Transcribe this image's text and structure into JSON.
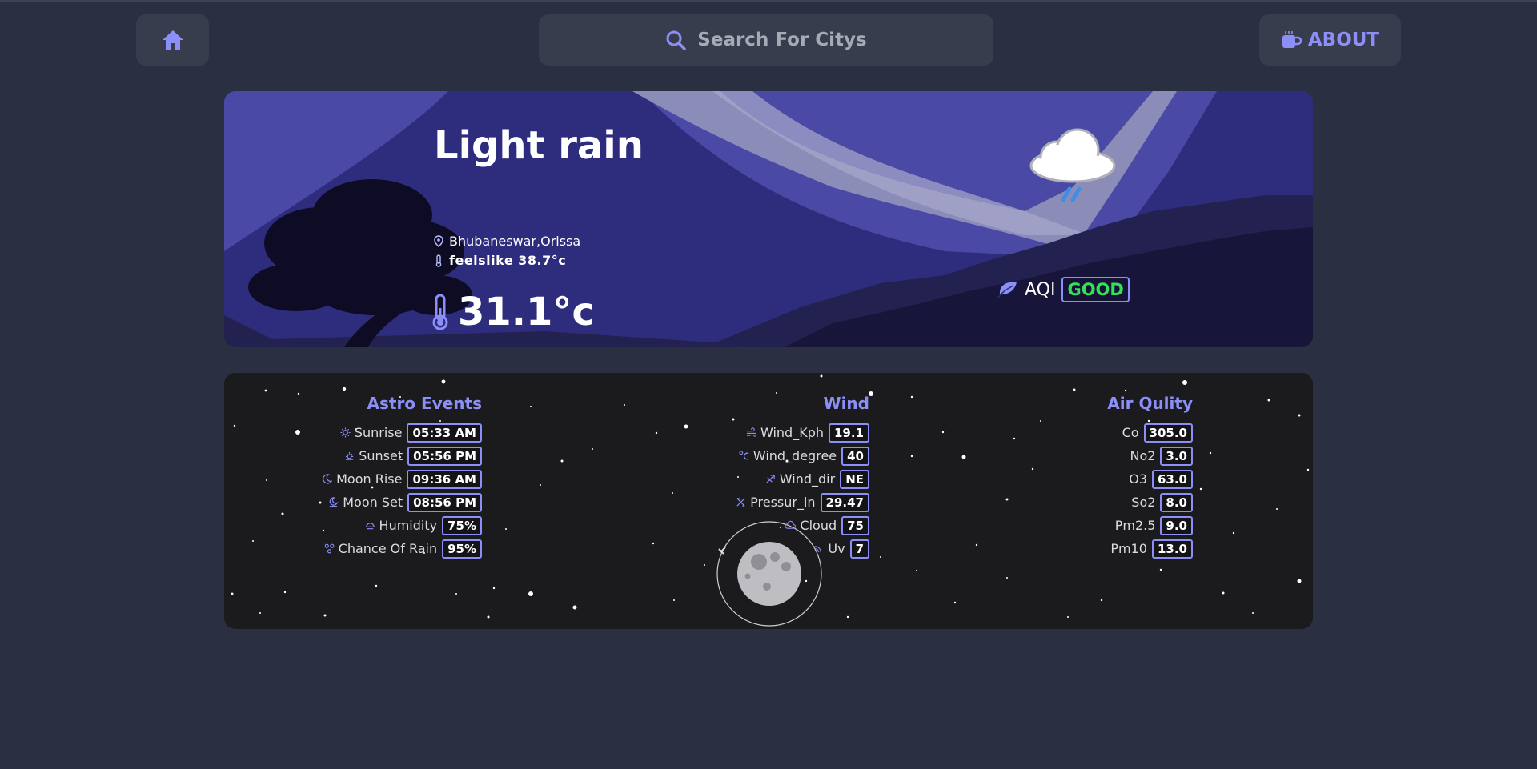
{
  "header": {
    "search_placeholder": "Search For Citys",
    "about_label": "ABOUT"
  },
  "current": {
    "condition": "Light rain",
    "location": "Bhubaneswar,Orissa",
    "feels_like": "feelslike 38.7°c",
    "temperature": "31.1°c",
    "aqi_label": "AQI",
    "aqi_status": "GOOD"
  },
  "astro": {
    "title": "Astro Events",
    "rows": [
      {
        "label": "Sunrise",
        "value": "05:33 AM",
        "icon": "sun-icon"
      },
      {
        "label": "Sunset",
        "value": "05:56 PM",
        "icon": "sunset-icon"
      },
      {
        "label": "Moon Rise",
        "value": "09:36 AM",
        "icon": "moon-icon"
      },
      {
        "label": "Moon Set",
        "value": "08:56 PM",
        "icon": "moonset-icon"
      },
      {
        "label": "Humidity",
        "value": "75%",
        "icon": "humidity-icon"
      },
      {
        "label": "Chance Of Rain",
        "value": "95%",
        "icon": "rain-chance-icon"
      }
    ]
  },
  "wind": {
    "title": "Wind",
    "rows": [
      {
        "label": "Wind_Kph",
        "value": "19.1",
        "icon": "wind-icon"
      },
      {
        "label": "Wind_degree",
        "value": "40",
        "icon": "degree-icon"
      },
      {
        "label": "Wind_dir",
        "value": "NE",
        "icon": "compass-icon"
      },
      {
        "label": "Pressur_in",
        "value": "29.47",
        "icon": "pressure-icon"
      },
      {
        "label": "Cloud",
        "value": "75",
        "icon": "cloud-icon"
      },
      {
        "label": "Uv",
        "value": "7",
        "icon": "uv-icon"
      }
    ]
  },
  "air": {
    "title": "Air Qulity",
    "rows": [
      {
        "label": "Co",
        "value": "305.0"
      },
      {
        "label": "No2",
        "value": "3.0"
      },
      {
        "label": "O3",
        "value": "63.0"
      },
      {
        "label": "So2",
        "value": "8.0"
      },
      {
        "label": "Pm2.5",
        "value": "9.0"
      },
      {
        "label": "Pm10",
        "value": "13.0"
      }
    ]
  },
  "colors": {
    "accent": "#8b8ff7",
    "good": "#33e056",
    "background": "#2a2f42"
  }
}
